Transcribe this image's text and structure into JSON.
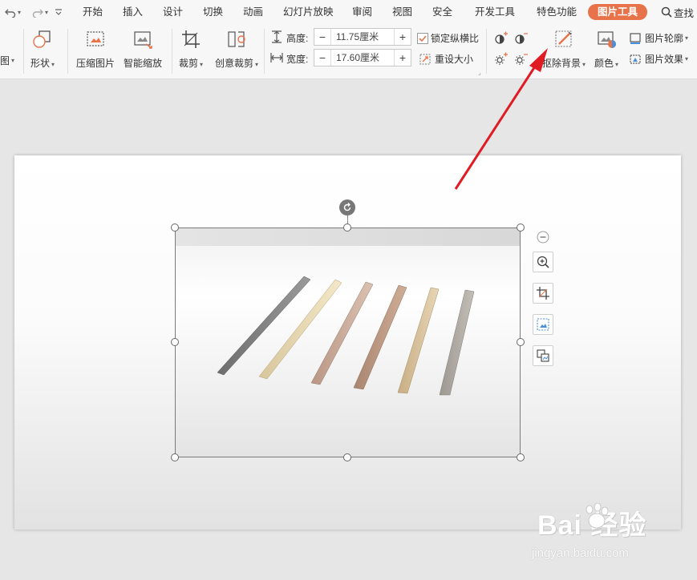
{
  "menubar": {
    "tabs": [
      "开始",
      "插入",
      "设计",
      "切换",
      "动画",
      "幻灯片放映",
      "审阅",
      "视图",
      "安全",
      "开发工具",
      "特色功能",
      "图片工具"
    ],
    "active_tab": "图片工具",
    "search_label": "查找",
    "active_color": "#e8734a"
  },
  "ribbon": {
    "partial_left_label": "图",
    "shape_label": "形状",
    "compress_label": "压缩图片",
    "smart_zoom_label": "智能缩放",
    "crop_label": "裁剪",
    "creative_crop_label": "创意裁剪",
    "height_label": "高度:",
    "height_value": "11.75厘米",
    "width_label": "宽度:",
    "width_value": "17.60厘米",
    "lock_ratio_label": "锁定纵横比",
    "reset_size_label": "重设大小",
    "remove_bg_label": "抠除背景",
    "color_label": "颜色",
    "outline_label": "图片轮廓",
    "effect_label": "图片效果",
    "minus_label": "−",
    "plus_label": "+"
  },
  "watermark": {
    "brand": "Bai  经验",
    "url": "jingyan.baidu.com"
  },
  "colors": {
    "arrow": "#e01b24",
    "accent": "#e8734a"
  }
}
